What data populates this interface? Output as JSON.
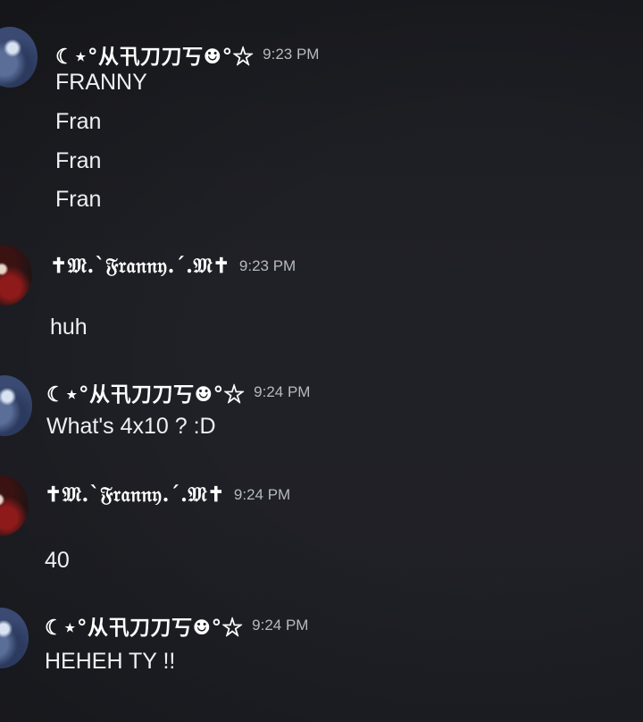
{
  "messages": [
    {
      "author": "☾⋆°从卂刀刀丂☻°☆",
      "time": "9:23 PM",
      "lines": [
        "FRANNY",
        "Fran",
        "Fran",
        "Fran"
      ]
    },
    {
      "author": "✝𝔐.`𝔉𝔯𝔞𝔫𝔫𝔶.´.𝔐✝",
      "time": "9:23 PM",
      "lines": [
        "huh"
      ]
    },
    {
      "author": "☾⋆°从卂刀刀丂☻°☆",
      "time": "9:24 PM",
      "lines": [
        "What's 4x10 ? :D"
      ]
    },
    {
      "author": "✝𝔐.`𝔉𝔯𝔞𝔫𝔫𝔶.´.𝔐✝",
      "time": "9:24 PM",
      "lines": [
        "40"
      ]
    },
    {
      "author": "☾⋆°从卂刀刀丂☻°☆",
      "time": "9:24 PM",
      "lines": [
        "HEHEH TY !!"
      ]
    }
  ]
}
